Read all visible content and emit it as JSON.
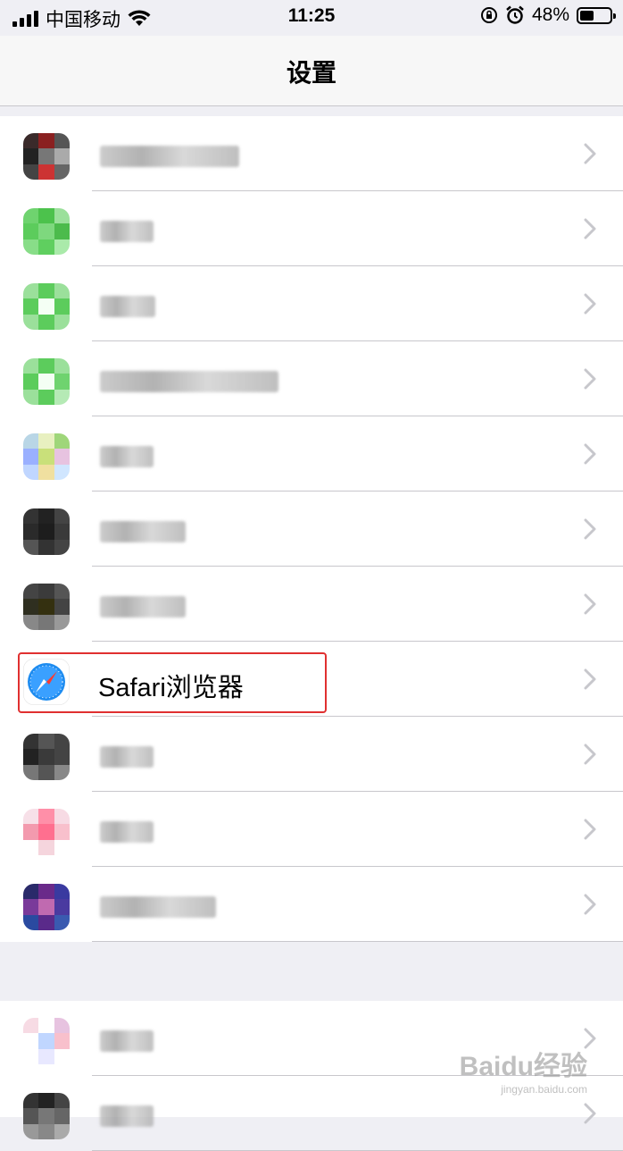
{
  "status_bar": {
    "carrier": "中国移动",
    "time": "11:25",
    "battery_percent": "48%",
    "battery_level": 0.48,
    "icons": [
      "signal-icon",
      "wifi-icon",
      "orientation-lock-icon",
      "alarm-icon",
      "battery-icon"
    ]
  },
  "nav": {
    "title": "设置"
  },
  "rows": [
    {
      "label": ""
    },
    {
      "label": ""
    },
    {
      "label": ""
    },
    {
      "label": ""
    },
    {
      "label": ""
    },
    {
      "label": ""
    },
    {
      "label": ""
    },
    {
      "label": "Safari浏览器",
      "icon": "safari-icon"
    },
    {
      "label": ""
    },
    {
      "label": ""
    },
    {
      "label": ""
    }
  ],
  "rows2": [
    {
      "label": ""
    },
    {
      "label": ""
    }
  ],
  "watermark": {
    "brand": "Baidu经验",
    "url": "jingyan.baidu.com"
  },
  "colors": {
    "highlight": "#e03030",
    "separator": "#c8c7cc",
    "chevron": "#c7c7cc"
  }
}
